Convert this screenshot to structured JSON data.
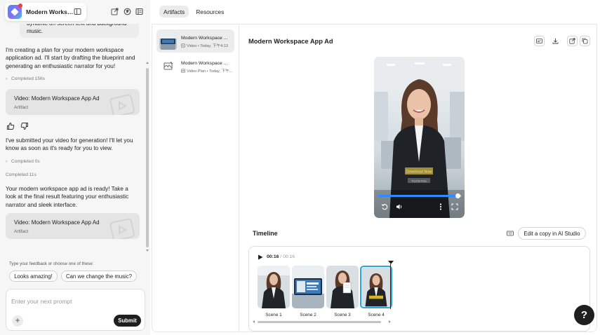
{
  "app": {
    "name": "Modern Workspace App Ad",
    "name_short": "Modern Works…"
  },
  "chat": {
    "user_message_tail": "dynamic on-screen text and background music.",
    "messages": [
      "I'm creating a plan for your modern workspace application ad. I'll start by drafting the blueprint and generating an enthusiastic narrator for you!",
      "I've submitted your video for generation! I'll let you know as soon as it's ready for you to view.",
      "Your modern workspace app ad is ready! Take a look at the final result featuring your enthusiastic narrator and sleek interface."
    ],
    "statuses": [
      "Completed 156s",
      "Completed 0s",
      "Completed 11s"
    ],
    "artifact_cards": [
      {
        "title": "Video: Modern Workspace App Ad",
        "subtitle": "Artifact"
      },
      {
        "title": "Video: Modern Workspace App Ad",
        "subtitle": "Artifact"
      }
    ]
  },
  "suggestions": {
    "label": "Type your feedback or choose one of these:",
    "chips": [
      "Looks amazing!",
      "Can we change the music?"
    ]
  },
  "prompt": {
    "placeholder": "Enter your next prompt",
    "submit_label": "Submit",
    "add_symbol": "+"
  },
  "tabs": [
    {
      "label": "Artifacts",
      "active": true
    },
    {
      "label": "Resources",
      "active": false
    }
  ],
  "artifacts": [
    {
      "name": "Modern Workspace ...",
      "meta": "Video • Today, 下午4:13",
      "selected": true,
      "icon": "video-icon"
    },
    {
      "name": "Modern Workspace ...",
      "meta": "Video Plan • Today, 下午...",
      "selected": false,
      "icon": "video-plan-icon"
    }
  ],
  "viewer": {
    "title": "Modern Workspace App Ad",
    "video_progress": 0.96
  },
  "timeline": {
    "title": "Timeline",
    "edit_label": "Edit a copy in AI Studio",
    "current_time": "00:16",
    "separator": " / ",
    "total_time": "00:16",
    "scenes": [
      "Scene 1",
      "Scene 2",
      "Scene 3",
      "Scene 4"
    ],
    "selected_scene": 4
  },
  "help": {
    "label": "?"
  },
  "colors": {
    "accent": "#2f8cff",
    "scene_selected": "#29a8d8",
    "dark_button": "#1f1f1f"
  }
}
